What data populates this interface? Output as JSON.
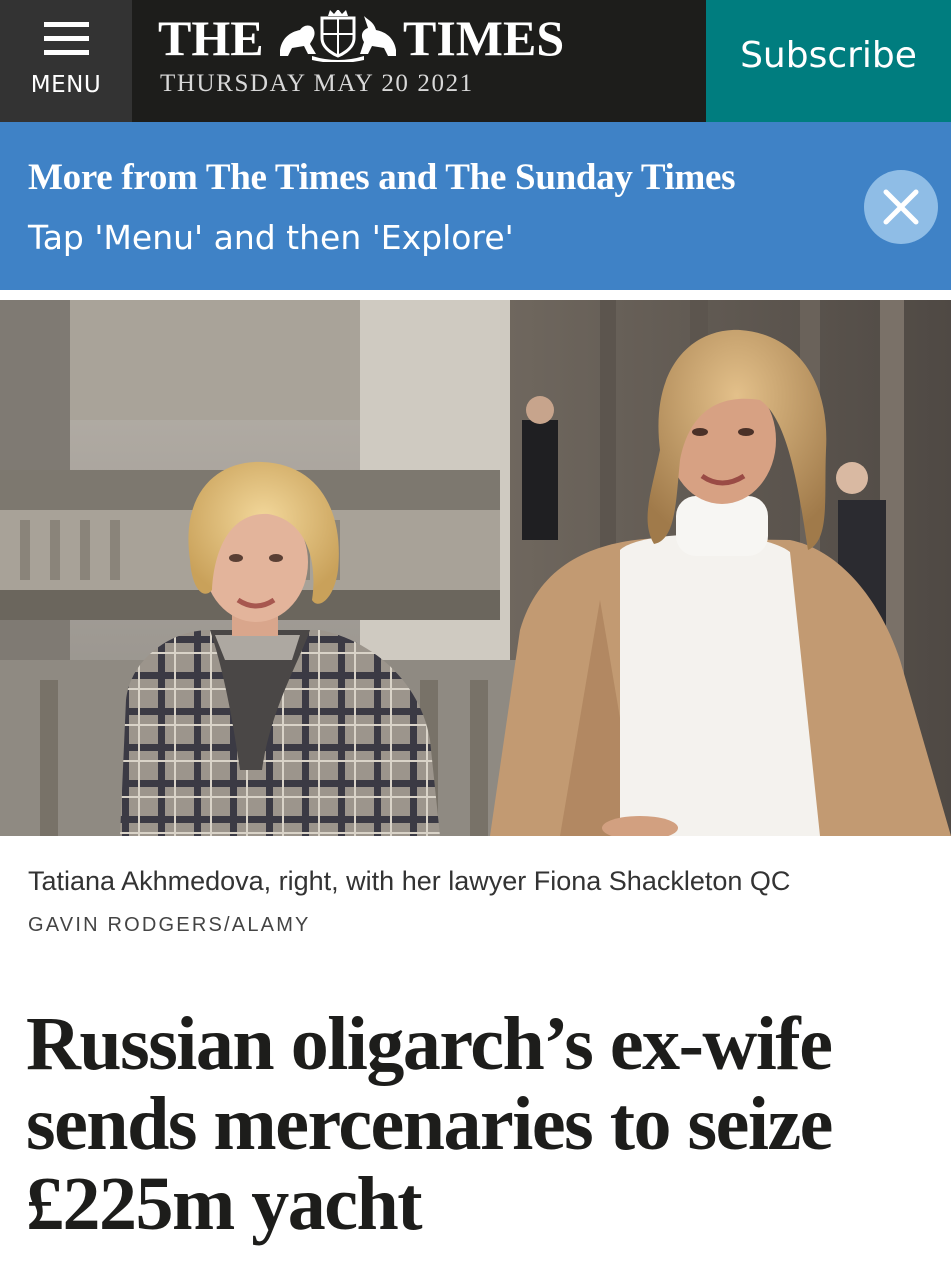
{
  "header": {
    "menu_label": "MENU",
    "masthead_left": "THE",
    "masthead_right": "TIMES",
    "date": "THURSDAY MAY 20 2021",
    "subscribe_label": "Subscribe",
    "colors": {
      "bar": "#1d1d1b",
      "menu_bg": "#333333",
      "subscribe_bg": "#007d7f"
    }
  },
  "promo": {
    "title": "More from The Times and The Sunday Times",
    "subtitle": "Tap 'Menu' and then 'Explore'",
    "color": "#3f82c6"
  },
  "article": {
    "image_alt": "Two women standing outside a stone court building",
    "caption": "Tatiana Akhmedova, right, with her lawyer Fiona Shackleton QC",
    "credit": "GAVIN RODGERS/ALAMY",
    "headline": "Russian oligarch’s ex-wife sends mercenaries to seize £225m yacht"
  }
}
